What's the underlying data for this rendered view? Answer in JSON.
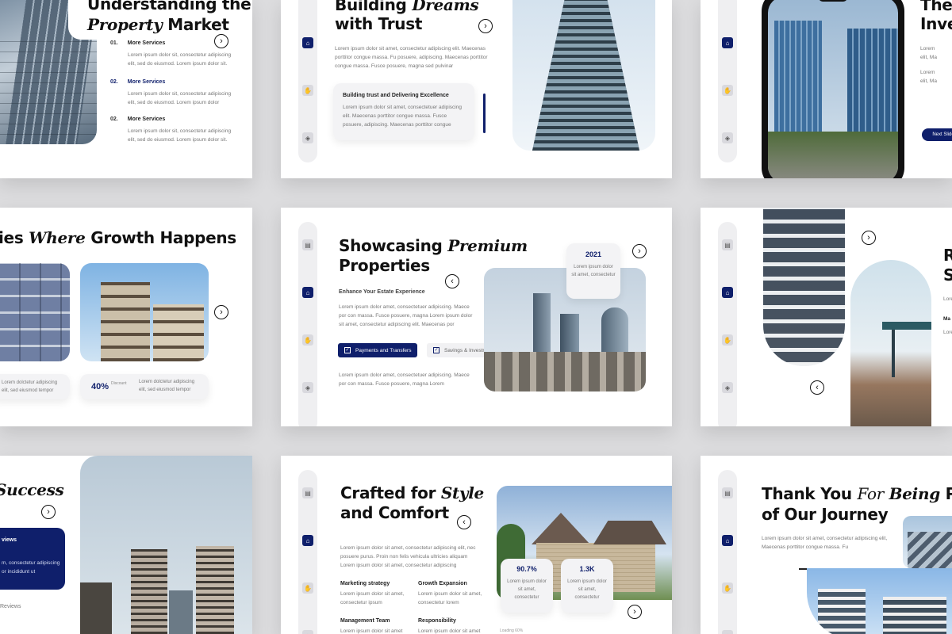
{
  "colors": {
    "brand_navy": "#0f1f6b",
    "background": "#dcdcde",
    "card": "#f3f3f5"
  },
  "slide1": {
    "title_a": "Understanding the",
    "title_em": "Property",
    "title_b": "Market",
    "items": [
      {
        "num": "01.",
        "label": "More Services",
        "text1": "Lorem ipsum dolor sit, consectetur adipiscing",
        "text2": "elit, sed do eiusmod. Lorem ipsum dolor sit."
      },
      {
        "num": "02.",
        "label": "More Services",
        "text1": "Lorem ipsum dolor sit, consectetur adipiscing",
        "text2": "elit, sed do eiusmod. Lorem ipsum dolor"
      },
      {
        "num": "02.",
        "label": "More Services",
        "text1": "Lorem ipsum dolor sit, consectetur adipiscing",
        "text2": "elit, sed do eiusmod. Lorem ipsum dolor sit."
      }
    ]
  },
  "slide2": {
    "title_a": "Building",
    "title_em": "Dreams",
    "title_b": "with Trust",
    "para": "Lorem ipsum dolor sit amet, consectetur adipiscing elit. Maecenas porttitor congue massa. Fu posuere, adipiscing. Maecenas porttitor congue massa. Fusce posuere, magna sed pulvinar",
    "card_title": "Building trust and Delivering Excellence",
    "card_text": "Lorem ipsum dolor sit amet, consectetuer adipiscing elit. Maecenas porttitor congue massa. Fusce posuere, adipiscing. Maecenas porttitor congue"
  },
  "slide3": {
    "title_a": "The",
    "title_b": "Inve",
    "lines": [
      "Lorem",
      "elit, Ma",
      "Lorem",
      "elit, Ma"
    ],
    "button": "Next Slide"
  },
  "slide4": {
    "title_a": "ies",
    "title_em": "Where",
    "title_b": "Growth Happens",
    "left_text": "Lorem dolctetur adipiscing elit, sed eiusmod tempor",
    "stat": "40%",
    "stat_label": "Discount",
    "right_text": "Lorem dolctetur adipiscing elit, sed eiusmod tempor"
  },
  "slide5": {
    "title_a": "Showcasing",
    "title_em": "Premium",
    "title_b": "Properties",
    "subtitle": "Enhance Your Estate Experience",
    "para1": "Lorem ipsum dolor amet, consectetuer adipiscing. Maece por con massa. Fusce posuere, magna Lorem ipsum dolor sit amet, consectetur adipiscing elit. Maecenas por",
    "chip1": "Payments and Transfers",
    "chip2": "Savings & Investments",
    "para2": "Lorem ipsum dolor amet, consectetuer adipiscing. Maece por con massa. Fusce posuere, magna Lorem",
    "year": "2021",
    "year_text": "Lorem ipsum dolor sit amet, consectetur"
  },
  "slide6": {
    "title_a": "R",
    "title_b": "S",
    "lines": [
      "Lorem",
      "Ma",
      "Lorem"
    ]
  },
  "slide7": {
    "title_em": "Success",
    "card_title": "views",
    "card_text": "m, consectetur adipiscing or incididunt ut",
    "footer": "Reviews"
  },
  "slide8": {
    "title_a": "Crafted for",
    "title_em": "Style",
    "title_b": "and Comfort",
    "para": "Lorem ipsum dolor sit amet, consectetur adipiscing elit, nec posuere purus. Proin non felis vehicula ultricies aliquam Lorem ipsum dolor sit amet, consectetur adipiscing",
    "cols": [
      {
        "label": "Marketing strategy",
        "text": "Lorem ipsum dolor sit amet, consectetur ipsum"
      },
      {
        "label": "Growth Expansion",
        "text": "Lorem ipsum dolor sit amet, consectetur lorem"
      },
      {
        "label": "Management Team",
        "text": "Lorem ipsum dolor sit amet"
      },
      {
        "label": "Responsibility",
        "text": "Lorem ipsum dolor sit amet"
      }
    ],
    "stat1": "90.7%",
    "stat1_text": "Lorem ipsum dolor sit amet, consectetur",
    "stat2": "1.3K",
    "stat2_text": "Lorem ipsum dolor sit amet, consectetur",
    "loading": "Loading 60%"
  },
  "slide9": {
    "title_a": "Thank You",
    "title_em1": "For",
    "title_em2": "Being",
    "title_b": "P",
    "title_c": "of Our Journey",
    "para": "Lorem ipsum dolor sit amet, consectetur adipiscing elit, Maecenas porttitor congue massa. Fu"
  },
  "rail_icons": [
    "document-icon",
    "home-icon",
    "hand-icon",
    "cube-icon"
  ]
}
